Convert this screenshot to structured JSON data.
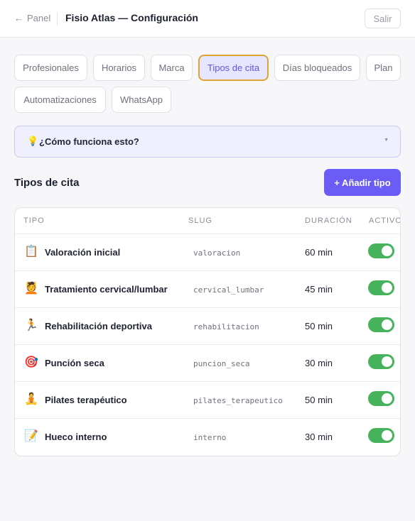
{
  "header": {
    "back_label": "Panel",
    "title": "Fisio Atlas — Configuración",
    "exit_label": "Salir"
  },
  "tabs": [
    {
      "label": "Profesionales",
      "active": false
    },
    {
      "label": "Horarios",
      "active": false
    },
    {
      "label": "Marca",
      "active": false
    },
    {
      "label": "Tipos de cita",
      "active": true
    },
    {
      "label": "Días bloqueados",
      "active": false
    },
    {
      "label": "Plan",
      "active": false
    },
    {
      "label": "Automatizaciones",
      "active": false
    },
    {
      "label": "WhatsApp",
      "active": false
    }
  ],
  "help": {
    "icon": "💡",
    "text": "¿Cómo funciona esto?"
  },
  "section": {
    "title": "Tipos de cita",
    "add_label": "+ Añadir tipo"
  },
  "table": {
    "columns": [
      "TIPO",
      "SLUG",
      "DURACIÓN",
      "ACTIVO"
    ],
    "rows": [
      {
        "icon": "📋",
        "icon_name": "clipboard-icon",
        "name": "Valoración inicial",
        "slug": "valoracion",
        "duration": "60 min",
        "active": true
      },
      {
        "icon": "💆",
        "icon_name": "massage-icon",
        "name": "Tratamiento cervical/lumbar",
        "slug": "cervical_lumbar",
        "duration": "45 min",
        "active": true
      },
      {
        "icon": "🏃",
        "icon_name": "runner-icon",
        "name": "Rehabilitación deportiva",
        "slug": "rehabilitacion",
        "duration": "50 min",
        "active": true
      },
      {
        "icon": "🎯",
        "icon_name": "target-icon",
        "name": "Punción seca",
        "slug": "puncion_seca",
        "duration": "30 min",
        "active": true
      },
      {
        "icon": "🧘",
        "icon_name": "yoga-icon",
        "name": "Pilates terapéutico",
        "slug": "pilates_terapeutico",
        "duration": "50 min",
        "active": true
      },
      {
        "icon": "📝",
        "icon_name": "memo-icon",
        "name": "Hueco interno",
        "slug": "interno",
        "duration": "30 min",
        "active": true
      }
    ]
  },
  "colors": {
    "accent": "#6a5cf5",
    "active_tab_border": "#e0a236",
    "toggle_on": "#46b35c"
  }
}
